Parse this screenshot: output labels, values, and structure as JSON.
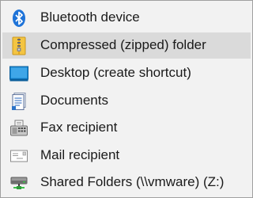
{
  "menu": {
    "items": [
      {
        "label": "Bluetooth device",
        "icon": "bluetooth-icon"
      },
      {
        "label": "Compressed (zipped) folder",
        "icon": "zip-folder-icon",
        "highlighted": true
      },
      {
        "label": "Desktop (create shortcut)",
        "icon": "desktop-icon"
      },
      {
        "label": "Documents",
        "icon": "documents-icon"
      },
      {
        "label": "Fax recipient",
        "icon": "fax-icon"
      },
      {
        "label": "Mail recipient",
        "icon": "mail-icon"
      },
      {
        "label": "Shared Folders (\\\\vmware) (Z:)",
        "icon": "network-drive-icon"
      }
    ]
  },
  "colors": {
    "menu_background": "#f2f2f2",
    "highlight": "#dadada",
    "border": "#a0a0a0",
    "bluetooth": "#1e73d8",
    "folder_yellow": "#f4c542",
    "desktop_blue": "#1a8ad4",
    "drive_green": "#3cc04a"
  }
}
